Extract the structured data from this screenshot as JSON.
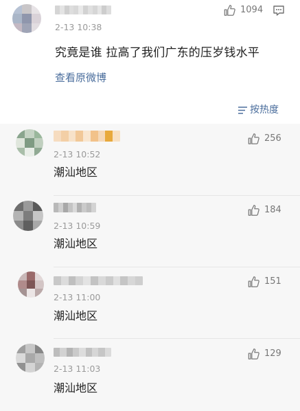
{
  "post": {
    "timestamp": "2-13 10:38",
    "likes": "1094",
    "text": "究竟是谁 拉高了我们广东的压岁钱水平",
    "view_original": "查看原微博"
  },
  "sort": {
    "label": "按热度"
  },
  "replies": [
    {
      "timestamp": "2-13 10:52",
      "text": "潮汕地区",
      "likes": "256"
    },
    {
      "timestamp": "2-13 10:59",
      "text": "潮汕地区",
      "likes": "184"
    },
    {
      "timestamp": "2-13 11:00",
      "text": "潮汕地区",
      "likes": "151"
    },
    {
      "timestamp": "2-13 11:03",
      "text": "潮汕地区",
      "likes": "129"
    }
  ],
  "icons": {
    "like": "thumbs-up-icon",
    "comment": "comment-icon",
    "sort": "sort-icon"
  },
  "colors": {
    "link": "#4a6d9c",
    "reply_background": "#f7f7f7",
    "highlight_name": "#f5c26b"
  },
  "redacted": {
    "post_avatar": [
      "#b7c2d4",
      "#c9c6c8",
      "#e7e3e6",
      "#aab6c8",
      "#8f96ac",
      "#d9d2d8",
      "#c4b9c3",
      "#9fa4b6",
      "#e2dde1"
    ],
    "post_name": [
      "#d5d5d5",
      "#e4e4e4",
      "#cfcfcf",
      "#dedede",
      "#d8d8d8",
      "#e9e9e9",
      "#d2d2d2",
      "#e0e0e0",
      "#d6d6d6",
      "#e5e5e5",
      "#cdcdcd",
      "#dddddd"
    ],
    "reply_avatars": [
      [
        "#8aa58e",
        "#c5d3c4",
        "#9ab79c",
        "#dfe6dc",
        "#7f9b83",
        "#c0cfbf",
        "#a9bea9",
        "#e9eee8",
        "#91aa94"
      ],
      [
        "#6e6e6e",
        "#9a9a9a",
        "#595959",
        "#b4b4b4",
        "#7d7d7d",
        "#c6c6c6",
        "#8b8b8b",
        "#5f5f5f",
        "#a8a8a8"
      ],
      [
        "#c9b8b8",
        "#9a6a6a",
        "#e2d8d8",
        "#b08b8b",
        "#7d5656",
        "#d3c5c5",
        "#a59393",
        "#ece6e6",
        "#bba9a9"
      ],
      [
        "#9f9f9f",
        "#c7c7c7",
        "#878787",
        "#dadada",
        "#a9a9a9",
        "#bfbfbf",
        "#929292",
        "#d4d4d4",
        "#b3b3b3"
      ]
    ],
    "reply_names": [
      [
        "#f6dcc0",
        "#f3cfa6",
        "#f7e2c9",
        "#f1c898",
        "#f9e6cf",
        "#f2c28a",
        "#f5d8b8",
        "#e8a93c",
        "#f8e0c2"
      ],
      [
        "#b9b9b9",
        "#cfcfcf",
        "#a8a8a8",
        "#c4c4c4",
        "#d9d9d9",
        "#b1b1b1",
        "#cacaca",
        "#bdbdbd",
        "#d3d3d3"
      ],
      [
        "#c8c8c8",
        "#dcdcdc",
        "#bfbfbf",
        "#d4d4d4",
        "#e3e3e3",
        "#c3c3c3",
        "#d9d9d9",
        "#cbcbcb",
        "#e0e0e0",
        "#c5c5c5",
        "#d7d7d7",
        "#cecece"
      ],
      [
        "#bdbdbd",
        "#d2d2d2",
        "#b4b4b4",
        "#cacaca",
        "#dddddd",
        "#c1c1c1",
        "#d6d6d6",
        "#c6c6c6",
        "#dbdbdb"
      ]
    ]
  }
}
